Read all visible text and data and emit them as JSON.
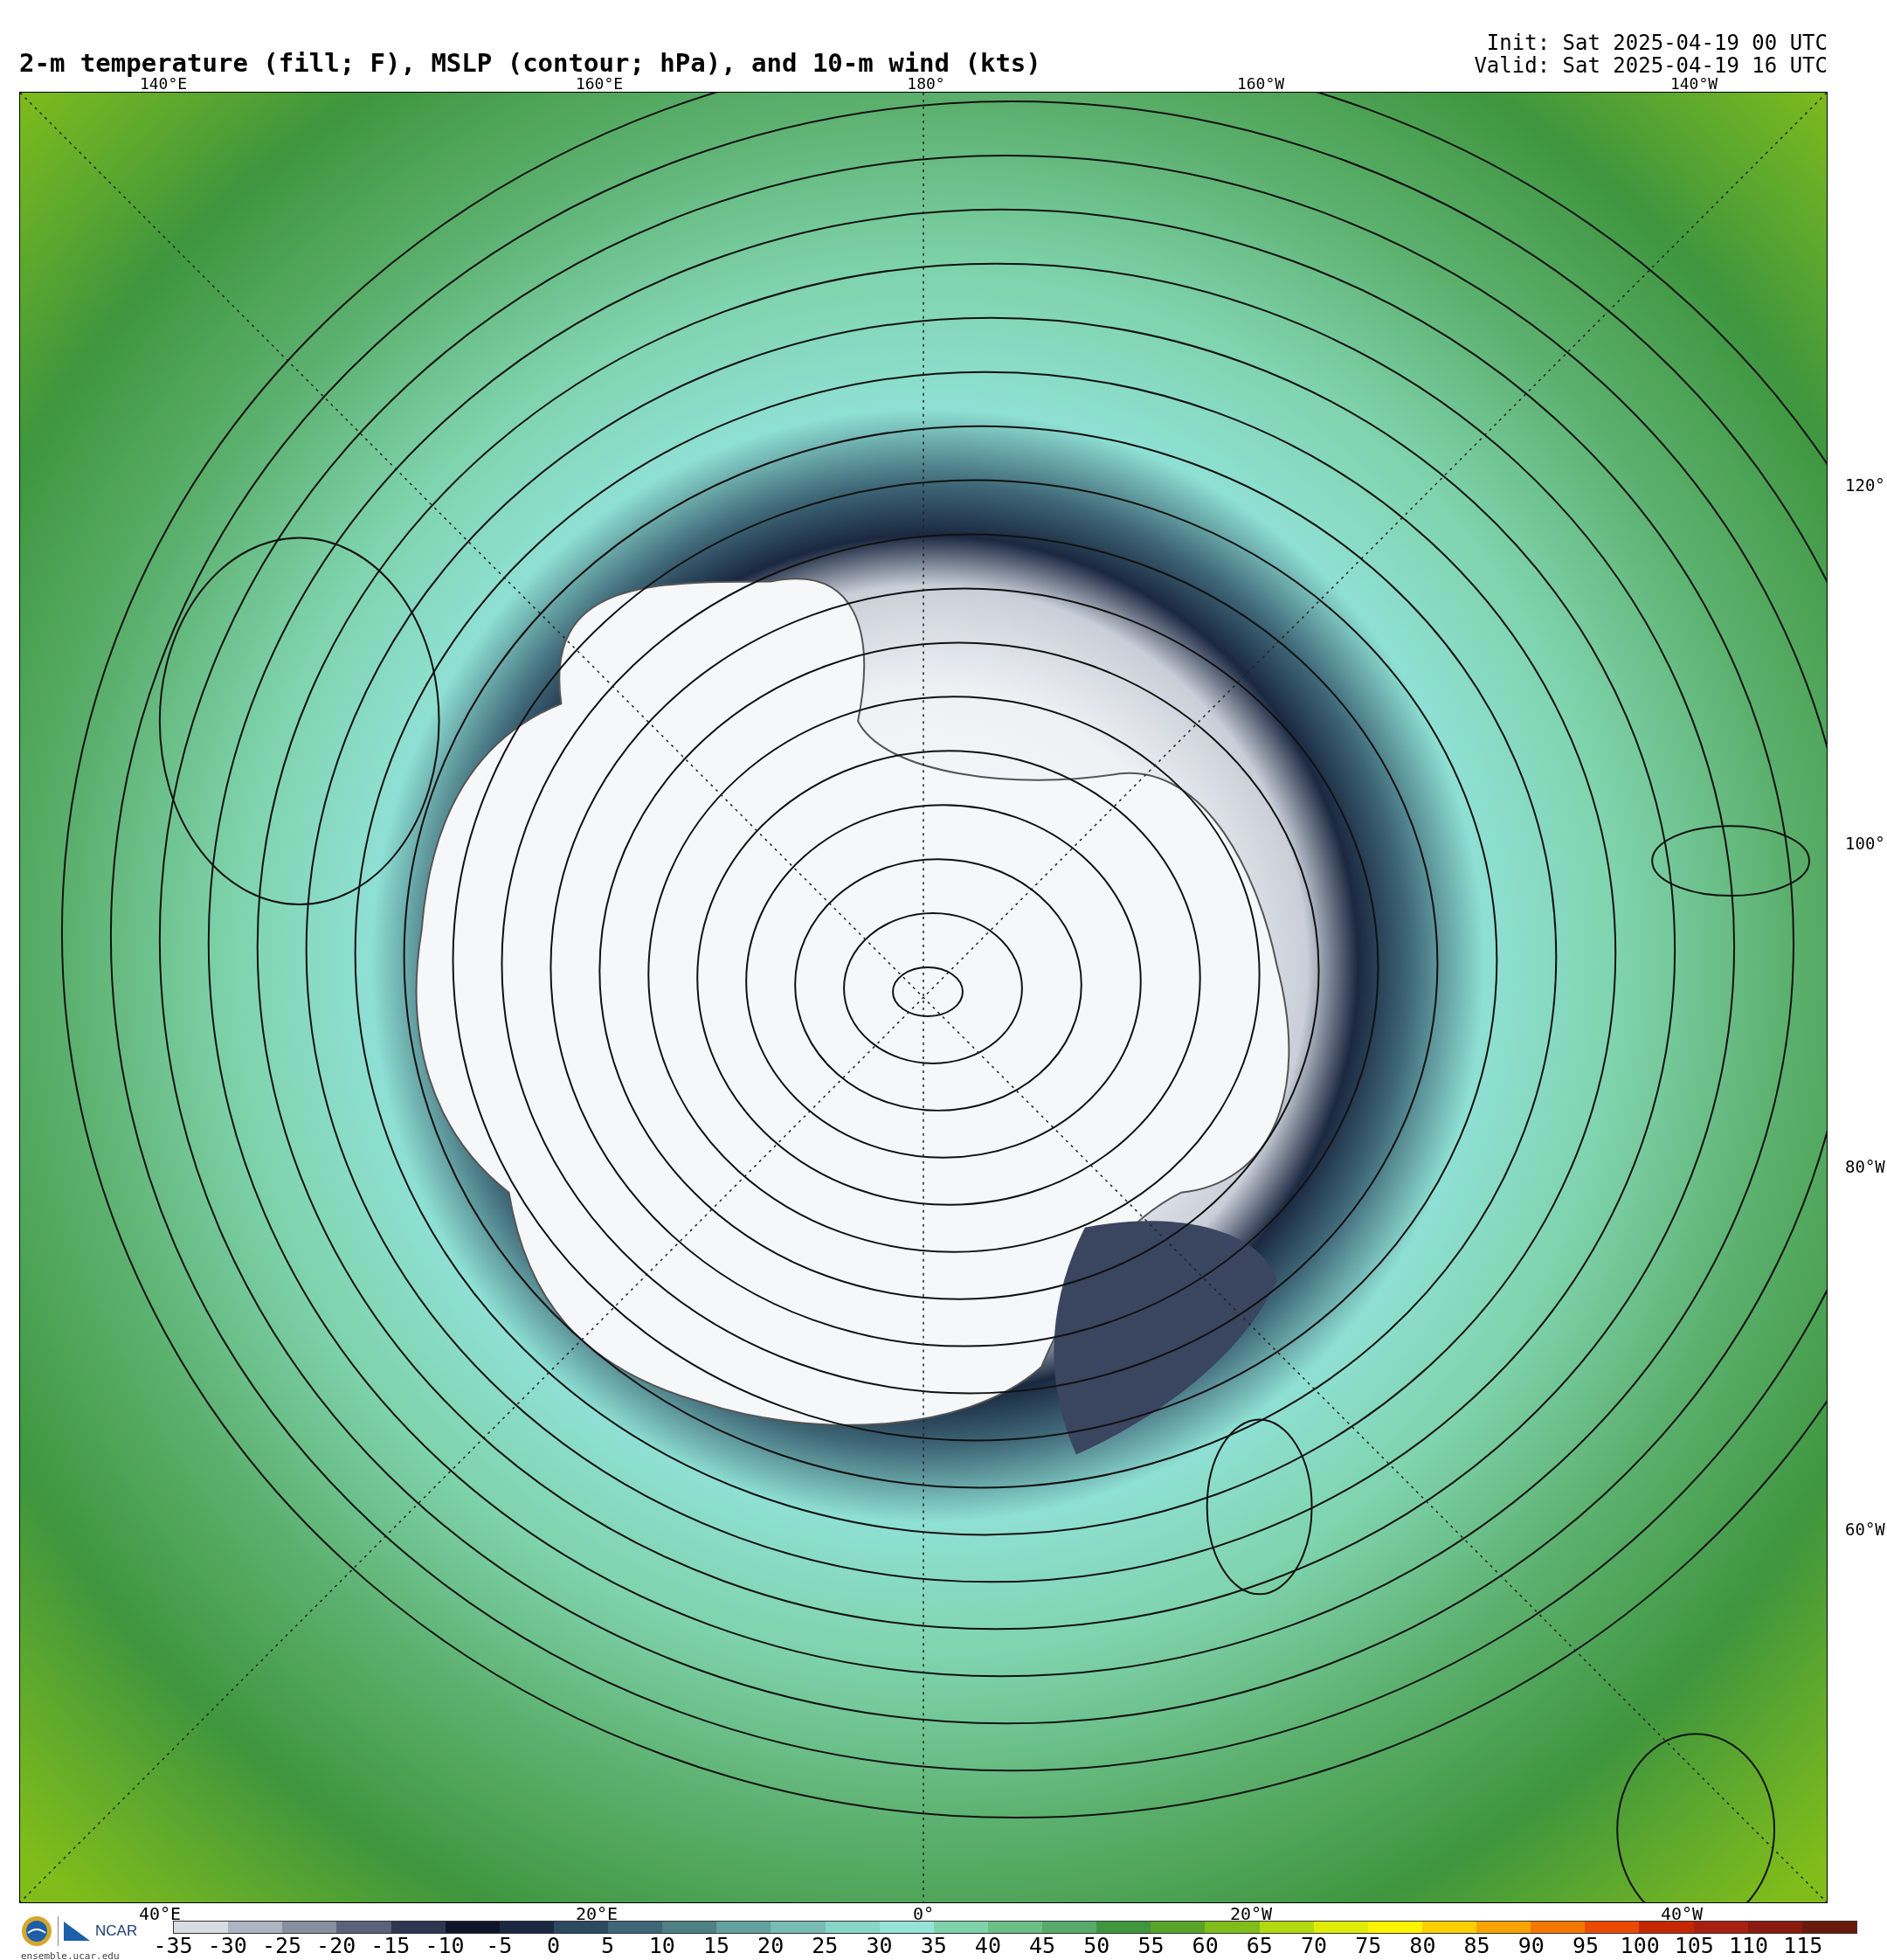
{
  "title": "2-m temperature (fill; F), MSLP (contour; hPa), and 10-m wind (kts)",
  "init": "Init: Sat 2025-04-19 00 UTC",
  "valid": "Valid: Sat 2025-04-19 16 UTC",
  "map": {
    "top_labels": [
      "140°E",
      "160°E",
      "180°",
      "160°W",
      "140°W"
    ],
    "right_labels": [
      "120°",
      "100°",
      "80°W",
      "60°W"
    ],
    "bottom_labels": [
      "40°E",
      "20°E",
      "0°",
      "20°W",
      "40°W"
    ]
  },
  "logos": {
    "org": "NCAR",
    "url": "ensemble.ucar.edu"
  },
  "colorbar": {
    "bins": [
      {
        "color": "#d9dce0"
      },
      {
        "color": "#aeb4c2"
      },
      {
        "color": "#878fa1"
      },
      {
        "color": "#5a6379"
      },
      {
        "color": "#2e3650"
      },
      {
        "color": "#0f1529"
      },
      {
        "color": "#1a2840"
      },
      {
        "color": "#2c4a60"
      },
      {
        "color": "#3e6676"
      },
      {
        "color": "#4e8086"
      },
      {
        "color": "#63a0a0"
      },
      {
        "color": "#78bcb4"
      },
      {
        "color": "#88d6c8"
      },
      {
        "color": "#96e4d8"
      },
      {
        "color": "#7fd3ac"
      },
      {
        "color": "#6bc087"
      },
      {
        "color": "#58ab6c"
      },
      {
        "color": "#3f963e"
      },
      {
        "color": "#58a428"
      },
      {
        "color": "#80bd1a"
      },
      {
        "color": "#b4d812"
      },
      {
        "color": "#e0ec08"
      },
      {
        "color": "#fdf400"
      },
      {
        "color": "#fdce00"
      },
      {
        "color": "#f8a300"
      },
      {
        "color": "#f47800"
      },
      {
        "color": "#ea4a00"
      },
      {
        "color": "#c42800"
      },
      {
        "color": "#a82010"
      },
      {
        "color": "#8a1a10"
      },
      {
        "color": "#6a1a0c"
      }
    ],
    "ticks": [
      "-35",
      "-30",
      "-25",
      "-20",
      "-15",
      "-10",
      "-5",
      "0",
      "5",
      "10",
      "15",
      "20",
      "25",
      "30",
      "35",
      "40",
      "45",
      "50",
      "55",
      "60",
      "65",
      "70",
      "75",
      "80",
      "85",
      "90",
      "95",
      "100",
      "105",
      "110",
      "115"
    ]
  }
}
